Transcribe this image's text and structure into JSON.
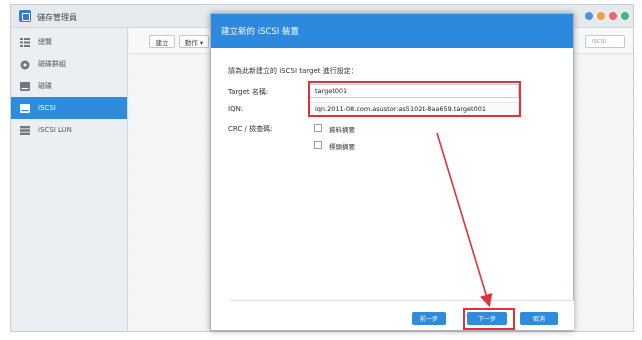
{
  "app": {
    "title": "儲存管理員"
  },
  "window_buttons": [
    {
      "name": "minimize",
      "color": "#4f92dd"
    },
    {
      "name": "maximize",
      "color": "#ef9f3c"
    },
    {
      "name": "close",
      "color": "#ec6a6a"
    },
    {
      "name": "extra",
      "color": "#3fb88a"
    }
  ],
  "sidebar": {
    "items": [
      {
        "label": "總覽",
        "icon": "overview-icon",
        "active": false
      },
      {
        "label": "磁碟群組",
        "icon": "disk-group-icon",
        "active": false
      },
      {
        "label": "磁碟",
        "icon": "volume-icon",
        "active": false
      },
      {
        "label": "iSCSI",
        "icon": "iscsi-icon",
        "active": true
      },
      {
        "label": "iSCSI LUN",
        "icon": "lun-icon",
        "active": false
      }
    ]
  },
  "toolbar": {
    "create_label": "建立",
    "action_label": "動作 ▾",
    "search_placeholder": "iSCSI"
  },
  "dialog": {
    "title": "建立新的 iSCSI 裝置",
    "intro": "請為此新建立的 iSCSI target 進行設定：",
    "target_name_label": "Target 名稱:",
    "target_name_value": "target001",
    "iqn_label": "IQN:",
    "iqn_value": "iqn.2011-08.com.asustor:as5102t-8aa659.target001",
    "crc_label": "CRC / 檢查碼:",
    "data_digest_label": "資料摘要",
    "header_digest_label": "標頭摘要"
  },
  "footer": {
    "prev_label": "前一步",
    "next_label": "下一步",
    "cancel_label": "取消"
  },
  "colors": {
    "accent": "#2f8bdc",
    "annotation": "#e0323a"
  }
}
